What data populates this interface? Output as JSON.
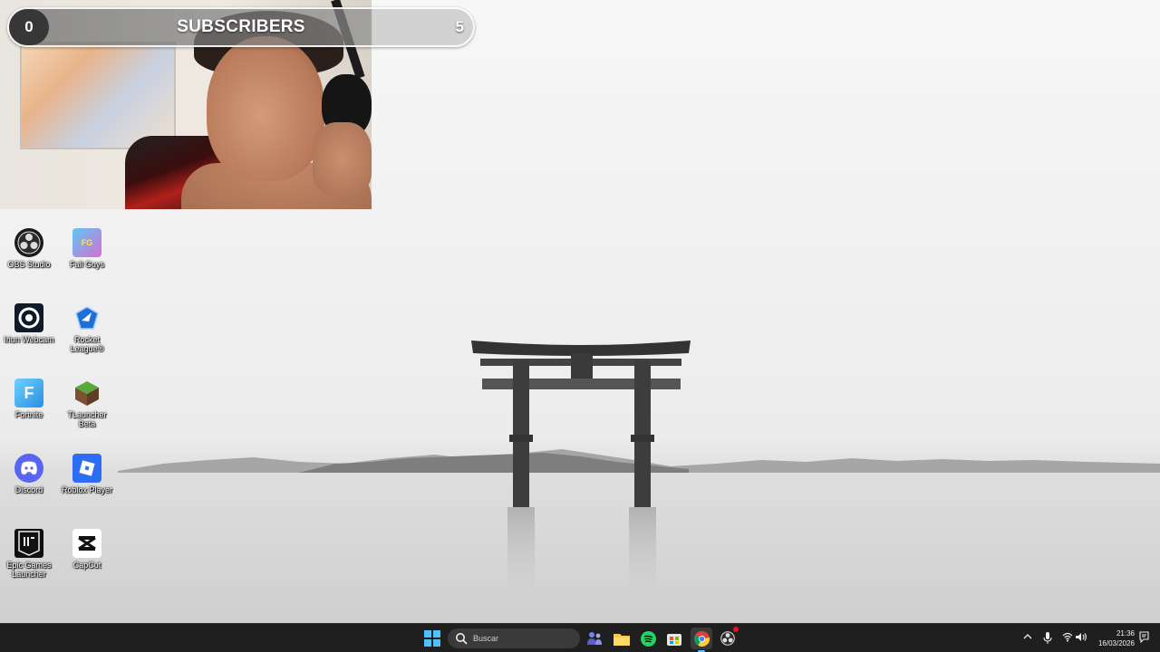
{
  "overlay": {
    "start_count": "0",
    "label": "SUBSCRIBERS",
    "goal_count": "5",
    "progress_fraction": 0
  },
  "desktop_icons": [
    {
      "label": "OBS Studio",
      "icon": "obs-icon"
    },
    {
      "label": "Fall Guys",
      "icon": "fall-guys-icon"
    },
    {
      "label": "Iriun Webcam",
      "icon": "webcam-icon"
    },
    {
      "label": "Rocket League®",
      "icon": "rocket-league-icon"
    },
    {
      "label": "Fortnite",
      "icon": "fortnite-icon"
    },
    {
      "label": "TLauncher Beta",
      "icon": "minecraft-block-icon"
    },
    {
      "label": "Discord",
      "icon": "discord-icon"
    },
    {
      "label": "Roblox Player",
      "icon": "roblox-icon"
    },
    {
      "label": "Epic Games Launcher",
      "icon": "epic-games-icon"
    },
    {
      "label": "CapCut",
      "icon": "capcut-icon"
    }
  ],
  "taskbar": {
    "search_placeholder": "Buscar",
    "apps": [
      "start-icon",
      "teams-icon",
      "file-explorer-icon",
      "spotify-icon",
      "store-icon",
      "chrome-icon",
      "obs-taskbar-icon"
    ],
    "time": "21:36",
    "date": "16/03/2026"
  }
}
